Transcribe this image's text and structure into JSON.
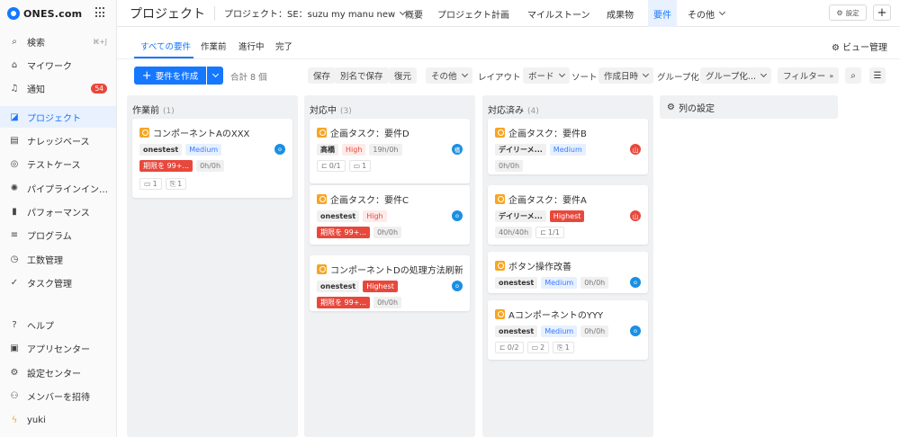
{
  "app": {
    "logo": "ONES.com"
  },
  "sidebar": {
    "items": [
      {
        "label": "検索",
        "icon": "search-icon",
        "shortcut": "⌘+J"
      },
      {
        "label": "マイワーク",
        "icon": "home-icon"
      },
      {
        "label": "通知",
        "icon": "bell-icon",
        "badge": "54"
      },
      {
        "label": "プロジェクト",
        "icon": "project-icon",
        "active": true
      },
      {
        "label": "ナレッジベース",
        "icon": "document-icon"
      },
      {
        "label": "テストケース",
        "icon": "testcase-icon"
      },
      {
        "label": "パイプラインインテ...",
        "icon": "pipeline-icon"
      },
      {
        "label": "パフォーマンス",
        "icon": "bar-chart-icon"
      },
      {
        "label": "プログラム",
        "icon": "program-icon"
      },
      {
        "label": "工数管理",
        "icon": "clock-icon"
      },
      {
        "label": "タスク管理",
        "icon": "task-icon"
      }
    ],
    "bottom_items": [
      {
        "label": "ヘルプ",
        "icon": "help-icon"
      },
      {
        "label": "アプリセンター",
        "icon": "app-center-icon"
      },
      {
        "label": "設定センター",
        "icon": "gear-icon"
      },
      {
        "label": "メンバーを招待",
        "icon": "invite-member-icon"
      },
      {
        "label": "yuki",
        "icon": "user-bolt-icon"
      }
    ]
  },
  "topbar": {
    "title": "プロジェクト",
    "project_selector": "プロジェクト：SE：suzu my manu new",
    "tabs": [
      "概要",
      "プロジェクト計画",
      "マイルストーン",
      "成果物",
      "要件",
      "その他"
    ],
    "active_tab": "要件",
    "settings_label": "設定"
  },
  "subtabs": {
    "items": [
      "すべての要件",
      "作業前",
      "進行中",
      "完了"
    ],
    "active": "すべての要件",
    "view_management": "ビュー管理"
  },
  "toolbar": {
    "create_label": "要件を作成",
    "total": "合計 8 個",
    "save": "保存",
    "save_as": "別名で保存",
    "restore": "復元",
    "more": "その他",
    "layout_label": "レイアウト",
    "layout_value": "ボード",
    "sort_label": "ソート",
    "sort_value": "作成日時",
    "group_label": "グループ化",
    "group_value": "グループ化...",
    "filter": "フィルター"
  },
  "board": {
    "columns": [
      {
        "name": "作業前",
        "count": "(1)",
        "cards": [
          {
            "title": "コンポーネントAのXXX",
            "owner": "onestest",
            "priority": "Medium",
            "priority_style": "blue",
            "avatar": "o",
            "avatar_color": "#1a8fe3",
            "row2": [
              {
                "text": "期限を 99+...",
                "style": "red"
              },
              {
                "text": "0h/0h",
                "style": "gray-light"
              }
            ],
            "row3": [
              {
                "icon": "comment-icon",
                "text": "1"
              },
              {
                "icon": "attachment-icon",
                "text": "1"
              }
            ]
          }
        ]
      },
      {
        "name": "対応中",
        "count": "(3)",
        "cards": [
          {
            "title": "企画タスク：要件D",
            "owner": "高橋",
            "priority": "High",
            "priority_style": "pink",
            "avatar": "橋",
            "avatar_color": "#1a8fe3",
            "extra": "19h/0h",
            "row3": [
              {
                "icon": "subtask-icon",
                "text": "0/1"
              },
              {
                "icon": "comment-icon",
                "text": "1"
              }
            ]
          },
          {
            "title": "企画タスク：要件C",
            "owner": "onestest",
            "priority": "High",
            "priority_style": "pink",
            "avatar": "o",
            "avatar_color": "#1a8fe3",
            "row2": [
              {
                "text": "期限を 99+...",
                "style": "red"
              },
              {
                "text": "0h/0h",
                "style": "gray-light"
              }
            ]
          },
          {
            "title": "コンポーネントDの処理方法刷新",
            "owner": "onestest",
            "priority": "Highest",
            "priority_style": "red-strong",
            "avatar": "o",
            "avatar_color": "#1a8fe3",
            "row2": [
              {
                "text": "期限を 99+...",
                "style": "red"
              },
              {
                "text": "0h/0h",
                "style": "gray-light"
              }
            ]
          }
        ]
      },
      {
        "name": "対応済み",
        "count": "(4)",
        "cards": [
          {
            "title": "企画タスク：要件B",
            "owner": "デイリーメ...",
            "priority": "Medium",
            "priority_style": "blue",
            "avatar": "山",
            "avatar_color": "#e8483c",
            "row2": [
              {
                "text": "0h/0h",
                "style": "gray-light"
              }
            ]
          },
          {
            "title": "企画タスク：要件A",
            "owner": "デイリーメ...",
            "priority": "Highest",
            "priority_style": "red-strong",
            "avatar": "山",
            "avatar_color": "#e8483c",
            "row2": [
              {
                "text": "40h/40h",
                "style": "gray-light"
              },
              {
                "icon": "subtask-icon",
                "text": "1/1",
                "style": "outline"
              }
            ]
          },
          {
            "title": "ボタン操作改善",
            "owner": "onestest",
            "priority": "Medium",
            "priority_style": "blue",
            "avatar": "o",
            "avatar_color": "#1a8fe3",
            "extra": "0h/0h"
          },
          {
            "title": "AコンポーネントのYYY",
            "owner": "onestest",
            "priority": "Medium",
            "priority_style": "blue",
            "avatar": "o",
            "avatar_color": "#1a8fe3",
            "extra": "0h/0h",
            "row3": [
              {
                "icon": "subtask-icon",
                "text": "0/2"
              },
              {
                "icon": "comment-icon",
                "text": "2"
              },
              {
                "icon": "attachment-icon",
                "text": "1"
              }
            ]
          }
        ]
      }
    ],
    "column_settings": "列の設定"
  }
}
